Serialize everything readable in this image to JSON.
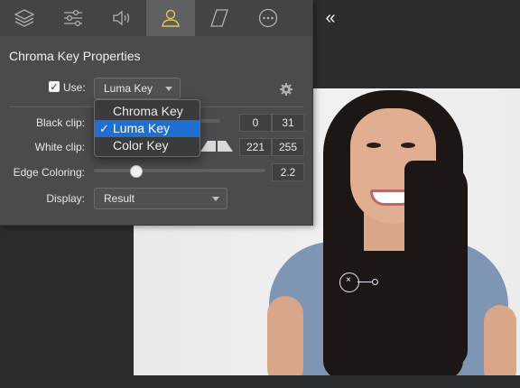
{
  "toolbar": {
    "tabs": [
      {
        "icon": "layers-icon"
      },
      {
        "icon": "sliders-icon"
      },
      {
        "icon": "speaker-icon"
      },
      {
        "icon": "person-icon",
        "active": true
      },
      {
        "icon": "parallelogram-icon"
      },
      {
        "icon": "more-icon"
      }
    ],
    "collapse_label": "«"
  },
  "panel": {
    "title": "Chroma Key Properties",
    "use": {
      "label": "Use:",
      "checked": true,
      "selected": "Luma Key"
    },
    "black_clip": {
      "label": "Black clip:",
      "low": "0",
      "high": "31"
    },
    "white_clip": {
      "label": "White clip:",
      "low": "221",
      "high": "255"
    },
    "edge_coloring": {
      "label": "Edge Coloring:",
      "value": "2.2",
      "slider_fraction": 0.24
    },
    "display": {
      "label": "Display:",
      "selected": "Result"
    }
  },
  "dropdown": {
    "options": [
      "Chroma Key",
      "Luma Key",
      "Color Key"
    ],
    "selected_index": 1,
    "check_glyph": "✓"
  },
  "colors": {
    "accent": "#1f6fd0",
    "active_tab": "#5f6062",
    "panel": "#4a4b4d"
  }
}
